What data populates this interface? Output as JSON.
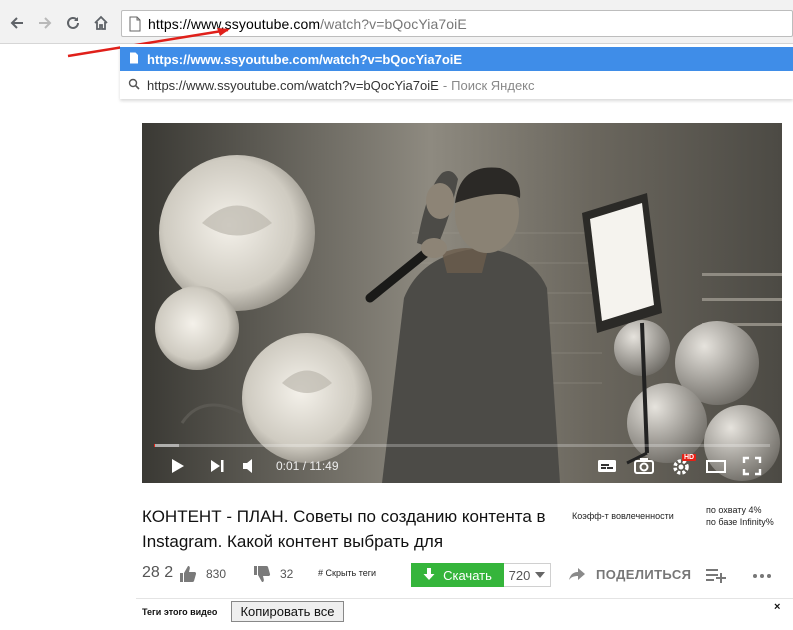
{
  "browser": {
    "url_host_prefix": "https://www.ssyoutube.com",
    "url_path": "/watch?v=bQocYia7oiE",
    "back_icon": "arrow-left-icon",
    "forward_icon": "arrow-right-icon",
    "reload_icon": "reload-icon",
    "home_icon": "home-icon"
  },
  "autocomplete": {
    "selected": "https://www.ssyoutube.com/watch?v=bQocYia7oiE",
    "search_query": "https://www.ssyoutube.com/watch?v=bQocYia7oiE",
    "search_separator": "-",
    "search_hint": "Поиск Яндекс"
  },
  "player": {
    "time": "0:01 / 11:49",
    "progress_played": 0.0014,
    "progress_buffered": 0.04,
    "hd_badge": "HD",
    "accent": "#e62117"
  },
  "video_info": {
    "title": "КОНТЕНТ - ПЛАН. Советы по созданию контента в Instagram. Какой контент выбрать для",
    "engagement_label": "Коэфф-т вовлеченности",
    "reach_line1": "по охвату 4%",
    "reach_line2": "по базе Infinity%",
    "views": "28 2",
    "likes": "830",
    "dislikes": "32",
    "hide_tags": "# Скрыть теги",
    "download_label": "Скачать",
    "quality": "720",
    "share_label": "ПОДЕЛИТЬСЯ",
    "download_color": "#35b53b"
  },
  "tags_bar": {
    "label": "Теги этого видео",
    "copy_all": "Копировать все",
    "close": "×"
  }
}
